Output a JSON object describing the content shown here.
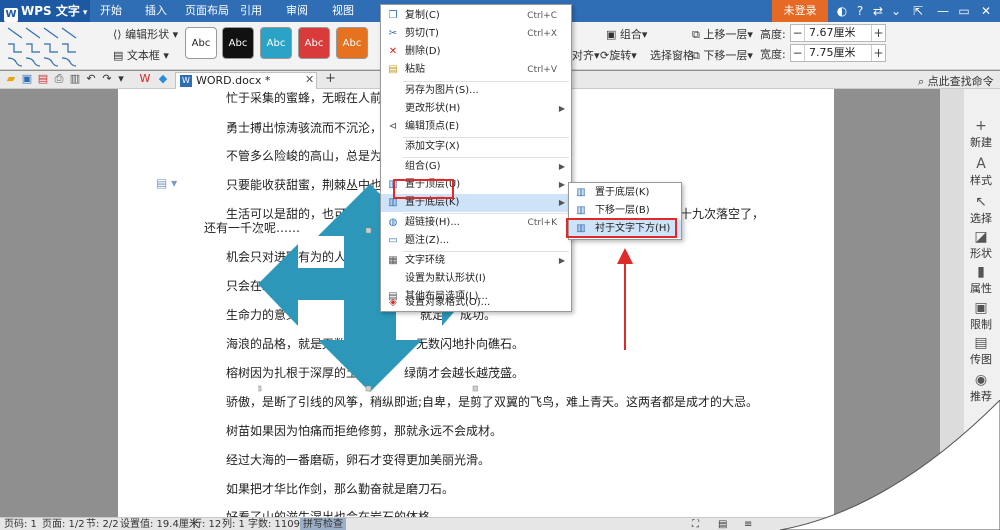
{
  "app": {
    "name": "WPS 文字",
    "menu_tabs": [
      "开始",
      "插入",
      "页面布局",
      "引用",
      "审阅",
      "视图"
    ],
    "login": "未登录"
  },
  "ribbon": {
    "edit_shape": "编辑形状",
    "text_box": "文本框",
    "style_label": "Abc",
    "align": "对齐",
    "rotate": "旋转",
    "combine": "组合",
    "select_pane": "选择窗格",
    "bring_forward": "上移一层",
    "send_backward": "下移一层",
    "height_label": "高度:",
    "height_value": "7.67厘米",
    "width_label": "宽度:",
    "width_value": "7.75厘米",
    "style_colors": [
      "#ffffff",
      "#111111",
      "#2aa3c6",
      "#d93a3a",
      "#e6711f"
    ]
  },
  "doc_tab": {
    "name": "WORD.docx *",
    "find": "点此查找命令"
  },
  "document": {
    "lines": [
      "忙于采集的蜜蜂，无暇在人前高谈",
      "勇士搏出惊涛骇流而不沉沦，懦夫",
      "不管多么险峻的高山，总是为不畏",
      "只要能收获甜蜜，荆棘丛中也会有",
      "生活可以是甜的，也可以是",
      "还有一千次呢……",
      "机会只对进取有为的人开放",
      "只会在水",
      "生命力的意义",
      "海浪的品格，就是无数次被",
      "榕树因为扎根于深厚的土壤",
      "骄傲，是断了引线的风筝，稍纵即逝;自卑，是剪了双翼的飞鸟，难上青天。这两者都是成才的大忌。",
      "树苗如果因为怕痛而拒绝修剪，那就永远不会成材。",
      "经过大海的一番磨砺，卵石才变得更加美丽光滑。",
      "如果把才华比作剑，那么勤奋就是磨刀石。",
      "好看了山的滋生湿出也会在岩石的体格"
    ],
    "line5_tail": "十九次落空了，",
    "line8_tail": "",
    "line9_tail": "就定",
    "line9_end": "成功。",
    "line10_tail": "一无数闪地扑向礁石。",
    "line11_tail": "绿荫才会越长越茂盛。"
  },
  "context_menu": {
    "items": [
      {
        "label": "复制(C)",
        "shortcut": "Ctrl+C",
        "icon": "copy-icon"
      },
      {
        "label": "剪切(T)",
        "shortcut": "Ctrl+X",
        "icon": "cut-icon"
      },
      {
        "label": "删除(D)",
        "shortcut": "",
        "icon": "delete-icon"
      },
      {
        "label": "粘贴",
        "shortcut": "Ctrl+V",
        "icon": "paste-icon"
      },
      {
        "label": "另存为图片(S)...",
        "shortcut": "",
        "icon": ""
      },
      {
        "label": "更改形状(H)",
        "shortcut": "",
        "icon": ""
      },
      {
        "label": "编辑顶点(E)",
        "shortcut": "",
        "icon": "edit-points-icon"
      },
      {
        "label": "添加文字(X)",
        "shortcut": "",
        "icon": ""
      },
      {
        "label": "组合(G)",
        "shortcut": "",
        "icon": ""
      },
      {
        "label": "置于顶层(U)",
        "shortcut": "",
        "icon": "bring-front-icon"
      },
      {
        "label": "置于底层(K)",
        "shortcut": "",
        "icon": "send-back-icon"
      },
      {
        "label": "超链接(H)...",
        "shortcut": "Ctrl+K",
        "icon": "hyperlink-icon"
      },
      {
        "label": "题注(Z)...",
        "shortcut": "",
        "icon": "caption-icon"
      },
      {
        "label": "文字环绕",
        "shortcut": "",
        "icon": "wrap-icon"
      },
      {
        "label": "设置为默认形状(I)",
        "shortcut": "",
        "icon": ""
      },
      {
        "label": "其他布局选项(L)...",
        "shortcut": "",
        "icon": "layout-icon"
      },
      {
        "label": "设置对象格式(O)...",
        "shortcut": "",
        "icon": "format-icon"
      }
    ]
  },
  "submenu": {
    "items": [
      {
        "label": "置于底层(K)"
      },
      {
        "label": "下移一层(B)"
      },
      {
        "label": "衬于文字下方(H)"
      }
    ]
  },
  "side_panel": [
    "新建",
    "样式",
    "选择",
    "形状",
    "属性",
    "限制",
    "传图",
    "推荐"
  ],
  "status": {
    "page_num": "页码: 1",
    "page": "页面: 1/2",
    "section": "节: 2/2",
    "setting": "设置值: 19.4厘米",
    "row": "行: 12",
    "col": "列: 1",
    "words": "字数: 1109",
    "spell": "拼写检查"
  }
}
